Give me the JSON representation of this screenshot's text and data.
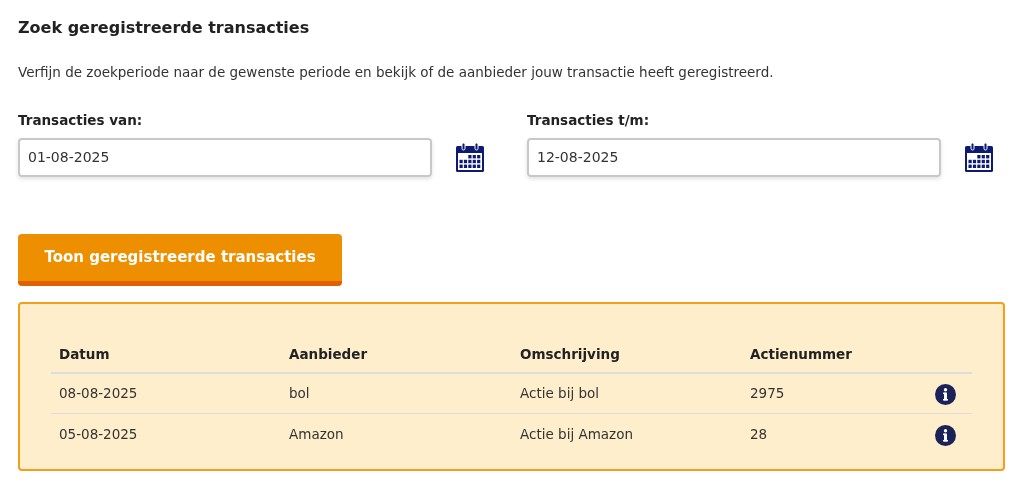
{
  "title": "Zoek geregistreerde transacties",
  "intro": "Verfijn de zoekperiode naar de gewenste periode en bekijk of de aanbieder jouw transactie heeft geregistreerd.",
  "fields": [
    {
      "label": "Transacties van:",
      "value": "01-08-2025"
    },
    {
      "label": "Transacties t/m:",
      "value": "12-08-2025"
    }
  ],
  "button": "Toon geregistreerde transacties",
  "table": {
    "columns": [
      "Datum",
      "Aanbieder",
      "Omschrijving",
      "Actienummer"
    ],
    "rows": [
      [
        "08-08-2025",
        "bol",
        "Actie bij bol",
        "2975"
      ],
      [
        "05-08-2025",
        "Amazon",
        "Actie bij Amazon",
        "28"
      ]
    ]
  }
}
